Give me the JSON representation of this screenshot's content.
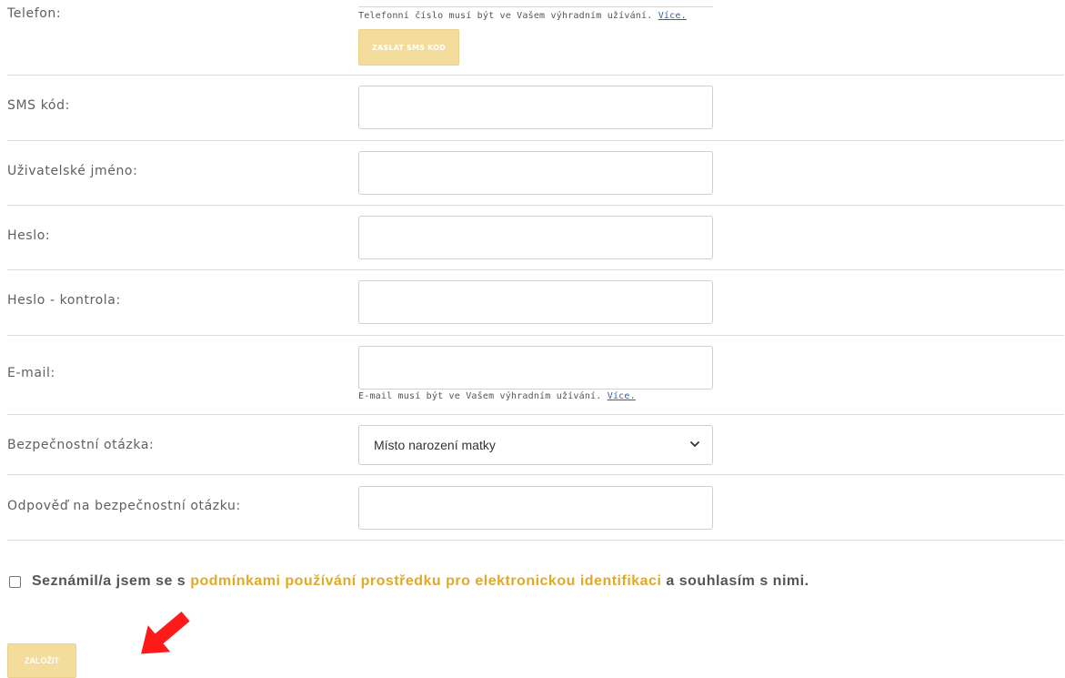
{
  "telefon": {
    "label": "Telefon:",
    "hint_text": "Telefonní číslo musí být ve Vašem výhradním užívání.",
    "hint_link": "Více.",
    "sms_button": "ZASLAT SMS KÓD"
  },
  "sms_kod": {
    "label": "SMS kód:",
    "value": ""
  },
  "username": {
    "label": "Uživatelské jméno:",
    "value": ""
  },
  "heslo": {
    "label": "Heslo:",
    "value": ""
  },
  "heslo_kontrola": {
    "label": "Heslo - kontrola:",
    "value": ""
  },
  "email": {
    "label": "E-mail:",
    "value": "",
    "hint_text": "E-mail musí být ve Vašem výhradním užívání.",
    "hint_link": "Více."
  },
  "security_question": {
    "label": "Bezpečnostní otázka:",
    "selected": "Místo narození matky"
  },
  "security_answer": {
    "label": "Odpověď na bezpečnostní otázku:",
    "value": ""
  },
  "consent": {
    "prefix": "Seznámil/a jsem se s",
    "link": "podmínkami používání prostředku pro elektronickou identifikaci",
    "suffix": "a souhlasím s nimi.",
    "checked": false
  },
  "submit_label": "ZALOŽIT",
  "colors": {
    "accent": "#e0a92a",
    "button_disabled": "#f3dc9c",
    "annotation_arrow": "#ff0000"
  }
}
